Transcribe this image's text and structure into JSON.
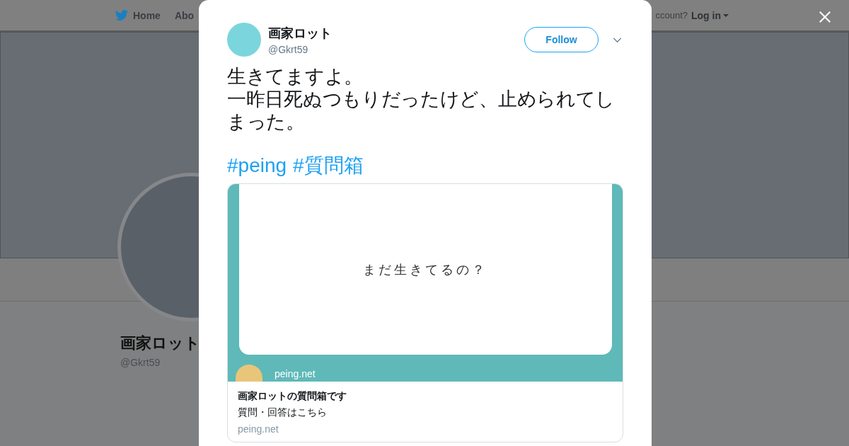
{
  "background_page": {
    "nav": [
      {
        "label": "Home"
      },
      {
        "label": "Abo"
      }
    ],
    "login_prompt": "ccount?",
    "login_link": "Log in",
    "profile": {
      "name": "画家ロット",
      "handle": "@Gkrt59"
    }
  },
  "tweet": {
    "author": {
      "name": "画家ロット",
      "handle": "@Gkrt59"
    },
    "follow_button": "Follow",
    "text_lines": [
      "生きてますよ。",
      "一昨日死ぬつもりだったけど、止められてしまった。"
    ],
    "hashtags": [
      "#peing",
      "#質問箱"
    ],
    "card": {
      "image_text": "まだ生きてるの？",
      "image_site": "peing.net",
      "title": "画家ロットの質問箱です",
      "description": "質問・回答はこちら",
      "domain": "peing.net"
    }
  }
}
